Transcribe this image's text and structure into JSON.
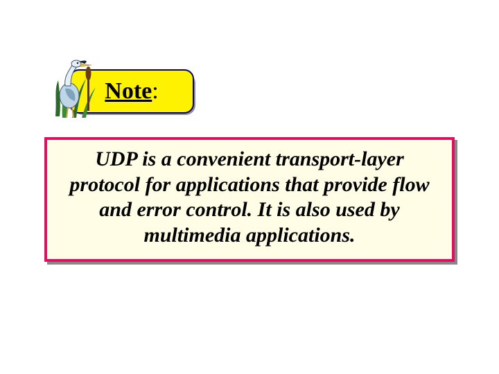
{
  "note": {
    "label_underlined": "Note",
    "label_suffix": ":"
  },
  "body": {
    "text": "UDP is a convenient transport-layer protocol for applications that provide flow and error control. It is also used by multimedia applications."
  },
  "colors": {
    "note_fill": "#fff200",
    "note_border": "#000080",
    "body_fill": "#fffde6",
    "body_border": "#e01060"
  },
  "icon": {
    "name": "heron-in-grass-icon"
  }
}
